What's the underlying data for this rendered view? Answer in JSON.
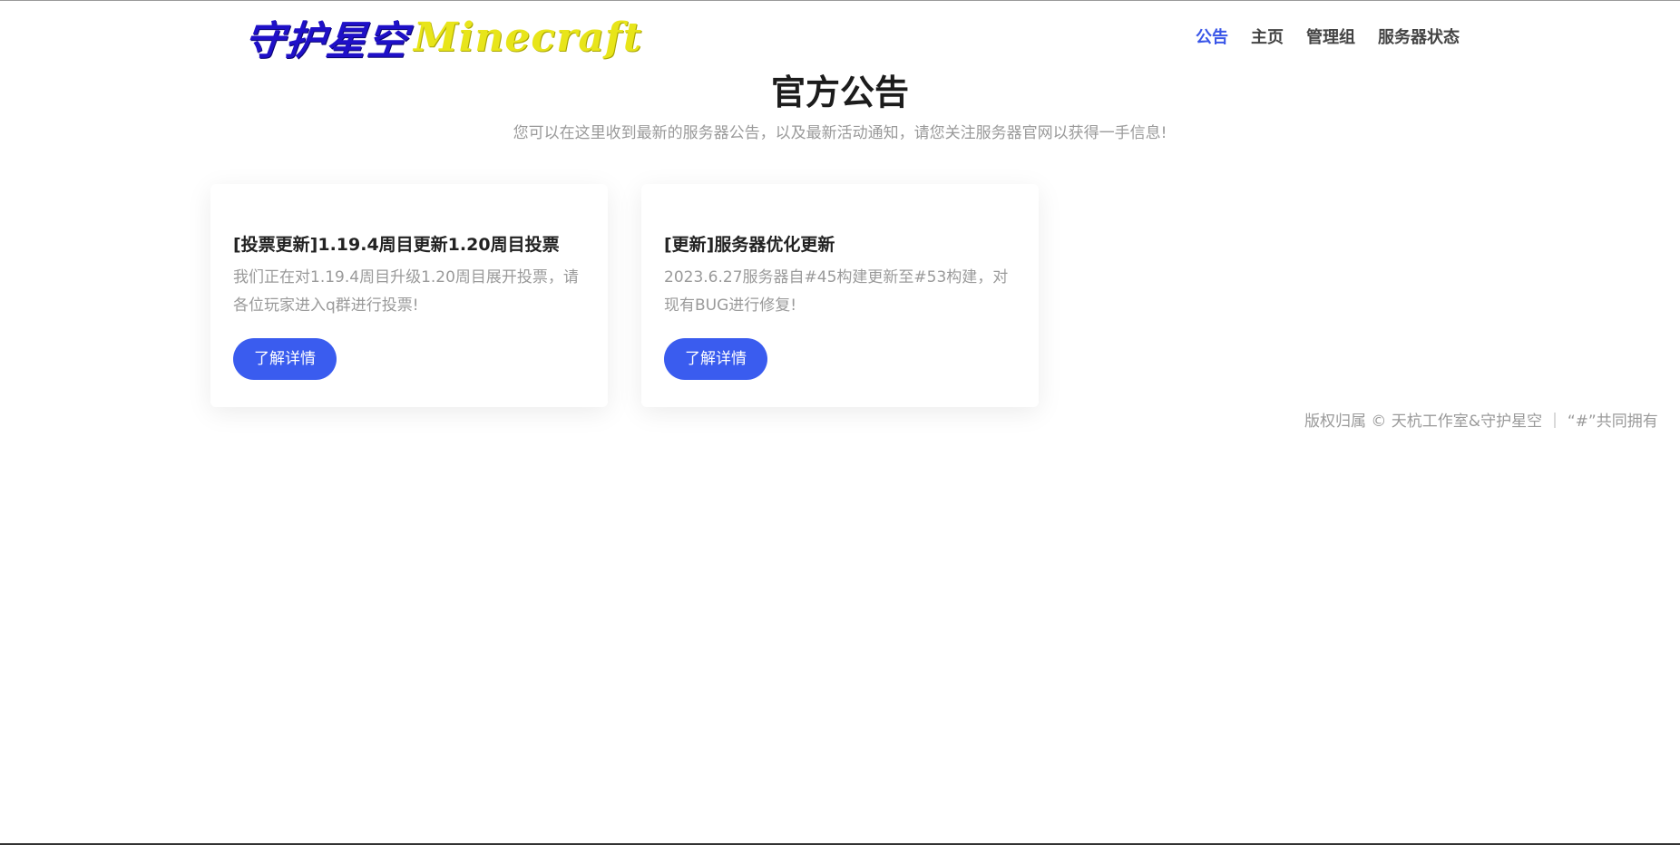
{
  "header": {
    "logo_cn": "守护星空",
    "logo_en": "Minecraft",
    "nav": [
      {
        "label": "公告",
        "active": true
      },
      {
        "label": "主页",
        "active": false
      },
      {
        "label": "管理组",
        "active": false
      },
      {
        "label": "服务器状态",
        "active": false
      }
    ]
  },
  "hero": {
    "title": "官方公告",
    "subtitle": "您可以在这里收到最新的服务器公告，以及最新活动通知，请您关注服务器官网以获得一手信息!"
  },
  "cards": [
    {
      "title": "[投票更新]1.19.4周目更新1.20周目投票",
      "text": "我们正在对1.19.4周目升级1.20周目展开投票，请各位玩家进入q群进行投票!",
      "button": "了解详情"
    },
    {
      "title": "[更新]服务器优化更新",
      "text": "2023.6.27服务器自#45构建更新至#53构建，对现有BUG进行修复!",
      "button": "了解详情"
    }
  ],
  "footer": {
    "text": "版权归属 © 天杭工作室&守护星空 ｜ “#”共同拥有"
  },
  "colors": {
    "accent": "#3a5cef",
    "nav_active": "#3a56e8",
    "logo_cn": "#1f10c8",
    "logo_en": "#e8e51a"
  }
}
